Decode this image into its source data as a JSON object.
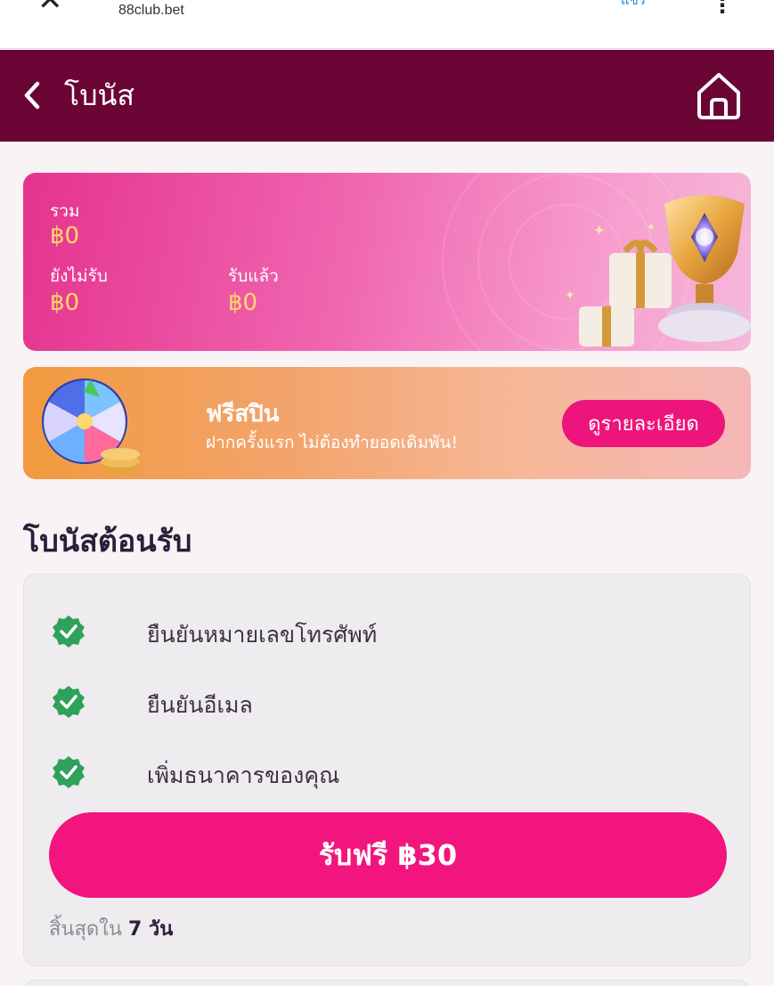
{
  "browser": {
    "url": "88club.bet",
    "close_glyph": "✕",
    "action_label": "แชร์",
    "menu_glyph": "⋮"
  },
  "header": {
    "title": "โบนัส",
    "back_icon": "chevron-left-icon",
    "home_icon": "home-icon",
    "background": "#6b0536"
  },
  "summary": {
    "total_label": "รวม",
    "total_value": "฿0",
    "unclaimed_label": "ยังไม่รับ",
    "unclaimed_value": "฿0",
    "claimed_label": "รับแล้ว",
    "claimed_value": "฿0",
    "value_color": "#ffd76a"
  },
  "free_spin": {
    "title": "ฟรีสปิน",
    "subtitle": "ฝากครั้งแรก ไม่ต้องทำยอดเดิมพัน!",
    "detail_button": "ดูรายละเอียด"
  },
  "welcome": {
    "section_title": "โบนัสต้อนรับ",
    "tasks": [
      {
        "label": "ยืนยันหมายเลขโทรศัพท์",
        "done": true
      },
      {
        "label": "ยืนยันอีเมล",
        "done": true
      },
      {
        "label": "เพิ่มธนาคารของคุณ",
        "done": true
      }
    ],
    "claim_button": "รับฟรี ฿30",
    "expire_prefix": "สิ้นสุดใน",
    "expire_value": "7 วัน",
    "accent": "#f2157e",
    "check_color": "#2fa15a"
  }
}
